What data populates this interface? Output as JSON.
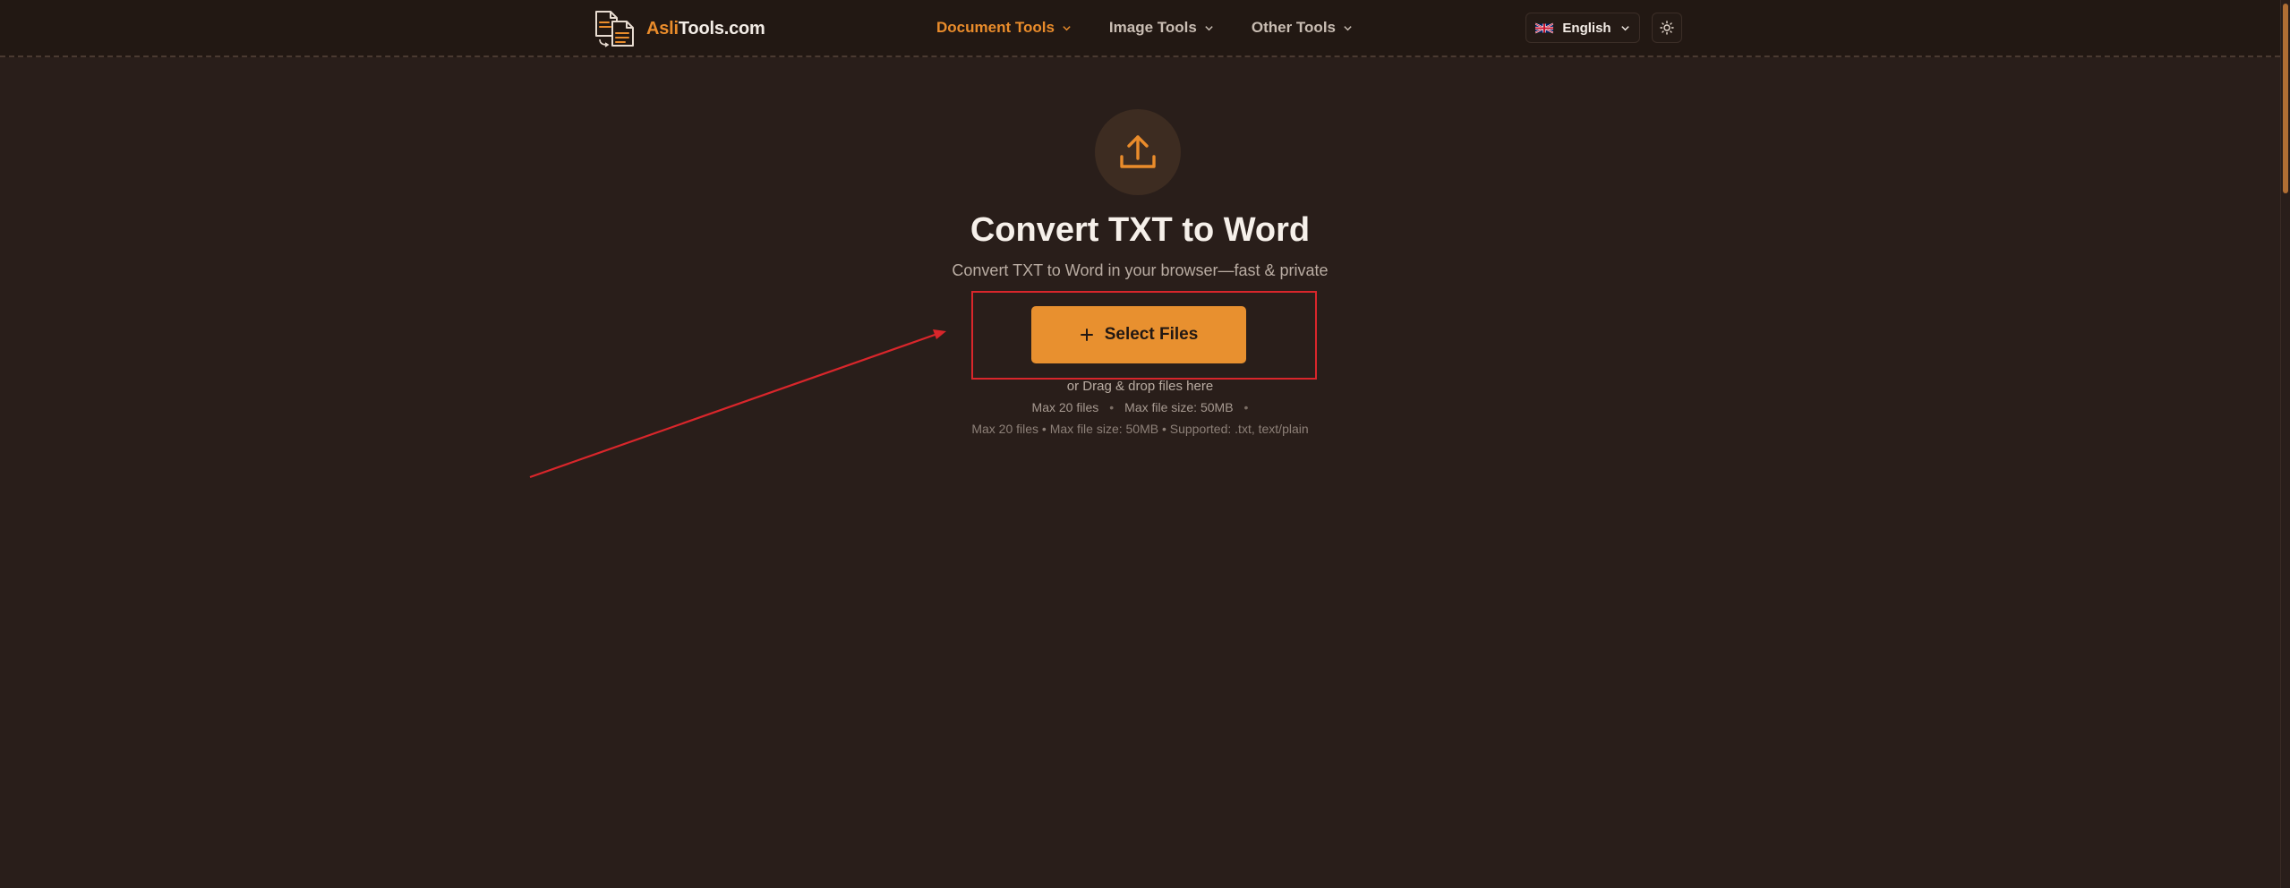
{
  "header": {
    "logo": {
      "accent": "Asli",
      "rest": "Tools.com"
    },
    "nav": [
      {
        "label": "Document Tools",
        "active": true
      },
      {
        "label": "Image Tools",
        "active": false
      },
      {
        "label": "Other Tools",
        "active": false
      }
    ],
    "language": "English",
    "icons": {
      "logo": "document-convert-icon",
      "flag": "uk-flag-icon",
      "theme": "sun-icon",
      "chevron": "chevron-down-icon"
    }
  },
  "main": {
    "upload_icon": "upload-icon",
    "title": "Convert TXT to Word",
    "subtitle": "Convert TXT to Word in your browser—fast & private",
    "select_button": "Select Files",
    "drag_text": "or Drag & drop files here",
    "limits": {
      "max_files": "Max 20 files",
      "max_size": "Max file size: 50MB"
    },
    "supported": "Max 20 files • Max file size: 50MB • Supported: .txt, text/plain"
  },
  "colors": {
    "accent": "#ea8c2b",
    "background": "#291e1a",
    "header": "#221813",
    "annotation": "#d9262b"
  }
}
